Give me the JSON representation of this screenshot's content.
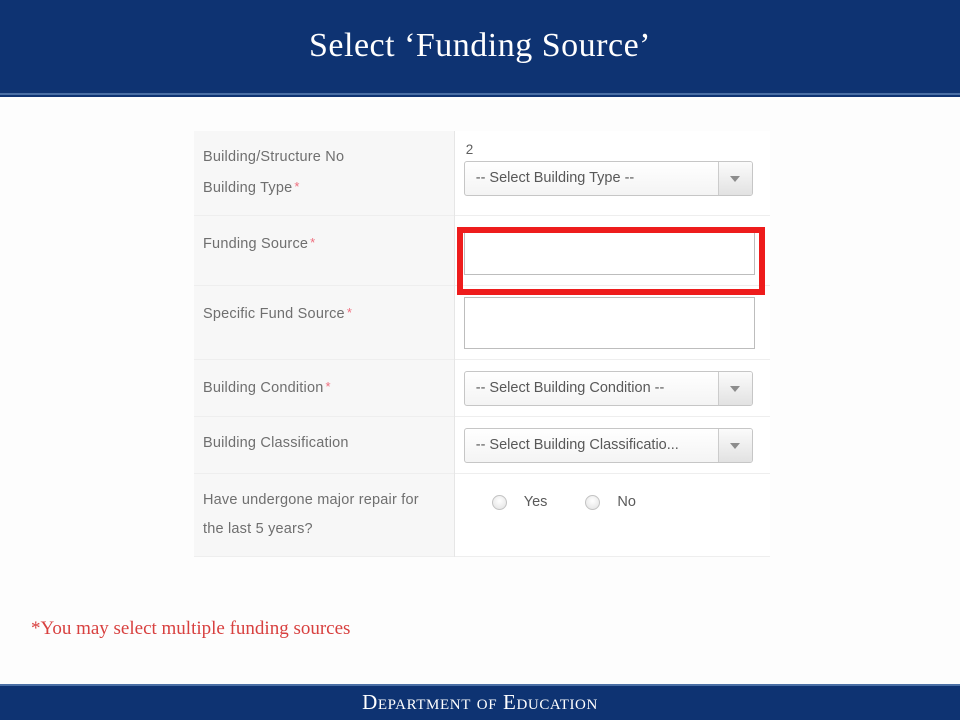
{
  "header": {
    "title": "Select ‘Funding Source’"
  },
  "form": {
    "rows": [
      {
        "label": "Building/Structure No",
        "required": false,
        "control": "text-value",
        "value": "2",
        "second_label": "Building Type",
        "second_required": true,
        "second_control": "select",
        "second_value": "-- Select Building Type --"
      },
      {
        "label": "Funding Source",
        "required": true,
        "control": "textbox",
        "value": "",
        "highlighted": true
      },
      {
        "label": "Specific Fund Source",
        "required": true,
        "control": "textbox",
        "value": ""
      },
      {
        "label": "Building Condition",
        "required": true,
        "control": "select",
        "value": "-- Select Building Condition --"
      },
      {
        "label": "Building Classification",
        "required": false,
        "control": "select",
        "value": "-- Select Building Classificatio..."
      },
      {
        "label": "Have undergone major repair for the last 5 years?",
        "required": false,
        "control": "radio",
        "options": [
          "Yes",
          "No"
        ]
      }
    ],
    "required_marker": "*"
  },
  "annotation": {
    "footnote": "*You may select multiple funding sources",
    "highlight_color": "#ee1c1c"
  },
  "footer": {
    "text": "Department of Education"
  },
  "theme": {
    "navy": "#0e3372",
    "accent_light_blue": "#4a6fa5",
    "required_red": "#ef6d7d",
    "note_red": "#d8403f",
    "label_gray": "#6f6f6f",
    "background": "#fdfdfd"
  }
}
